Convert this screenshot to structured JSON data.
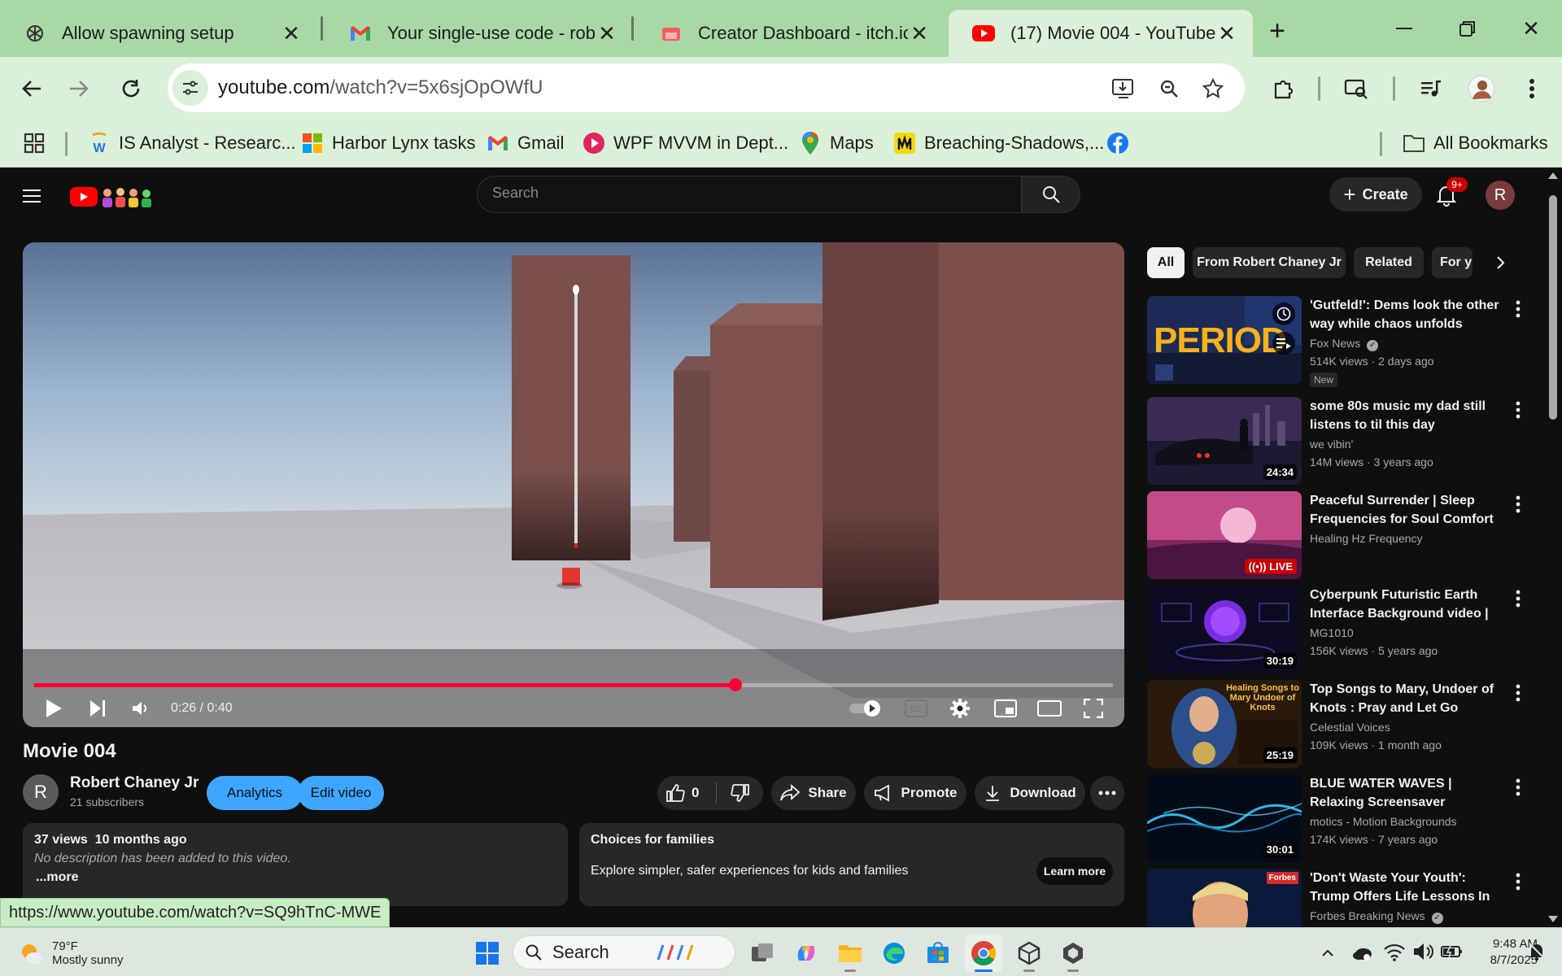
{
  "browser": {
    "tabs": [
      {
        "title": "Allow spawning setup",
        "active": false
      },
      {
        "title": "Your single-use code - rober",
        "active": false
      },
      {
        "title": "Creator Dashboard - itch.io",
        "active": false
      },
      {
        "title": "(17) Movie 004 - YouTube",
        "active": true
      }
    ],
    "url_host": "youtube.com",
    "url_path": "/watch?v=5x6sjOpOWfU",
    "bookmarks": [
      {
        "label": "IS Analyst - Researc...",
        "icon": "w-icon"
      },
      {
        "label": "Harbor Lynx tasks",
        "icon": "microsoft-icon"
      },
      {
        "label": "Gmail",
        "icon": "gmail-icon"
      },
      {
        "label": "WPF MVVM in Dept...",
        "icon": "play-icon"
      },
      {
        "label": "Maps",
        "icon": "maps-icon"
      },
      {
        "label": "Breaching-Shadows,...",
        "icon": "itch-icon"
      },
      {
        "label": "",
        "icon": "facebook-icon"
      }
    ],
    "all_bookmarks": "All Bookmarks"
  },
  "youtube": {
    "search_placeholder": "Search",
    "create_label": "Create",
    "notif_badge": "9+",
    "avatar_letter": "R",
    "player": {
      "time": "0:26 / 0:40",
      "progress": 0.65
    },
    "video": {
      "title": "Movie 004",
      "channel": "Robert Chaney Jr",
      "channel_letter": "R",
      "subscribers": "21 subscribers",
      "analytics_label": "Analytics",
      "edit_label": "Edit video",
      "likes": "0",
      "share_label": "Share",
      "promote_label": "Promote",
      "download_label": "Download"
    },
    "description": {
      "stats": "37 views  10 months ago",
      "text": "No description has been added to this video.",
      "more": "...more"
    },
    "families": {
      "title": "Choices for families",
      "text": "Explore simpler, safer experiences for kids and families",
      "button": "Learn more"
    },
    "chips": [
      "All",
      "From Robert Chaney Jr",
      "Related",
      "For y"
    ],
    "recommendations": [
      {
        "title": "'Gutfeld!': Dems look the other way while chaos unfolds",
        "channel": "Fox News",
        "verified": true,
        "meta": "514K views · 2 days ago",
        "badge": "New",
        "duration": "",
        "thumb_text": "PERIOD"
      },
      {
        "title": "some 80s music my dad still listens to til this day",
        "channel": "we vibin'",
        "verified": false,
        "meta": "14M views · 3 years ago",
        "badge": "",
        "duration": "24:34",
        "thumb_text": ""
      },
      {
        "title": "Peaceful Surrender | Sleep Frequencies for Soul Comfort",
        "channel": "Healing Hz Frequency",
        "verified": false,
        "meta": "",
        "badge": "",
        "duration": "LIVE",
        "thumb_text": ""
      },
      {
        "title": "Cyberpunk Futuristic Earth Interface Background video | ...",
        "channel": "MG1010",
        "verified": false,
        "meta": "156K views · 5 years ago",
        "badge": "",
        "duration": "30:19",
        "thumb_text": ""
      },
      {
        "title": "Top Songs to Mary, Undoer of Knots : Pray and Let Go",
        "channel": "Celestial Voices",
        "verified": false,
        "meta": "109K views · 1 month ago",
        "badge": "",
        "duration": "25:19",
        "thumb_text": "Healing Songs to Mary Undoer of Knots"
      },
      {
        "title": "BLUE WATER WAVES | Relaxing Screensaver",
        "channel": "motics - Motion Backgrounds",
        "verified": false,
        "meta": "174K views · 7 years ago",
        "badge": "",
        "duration": "30:01",
        "thumb_text": ""
      },
      {
        "title": "'Don't Waste Your Youth': Trump Offers Life Lessons In ...",
        "channel": "Forbes Breaking News",
        "verified": true,
        "meta": "",
        "badge": "",
        "duration": "",
        "thumb_text": "Forbes"
      }
    ]
  },
  "status_url": "https://www.youtube.com/watch?v=SQ9hTnC-MWE",
  "taskbar": {
    "weather_temp": "79°F",
    "weather_desc": "Mostly sunny",
    "search_label": "Search",
    "time": "9:48 AM",
    "date": "8/7/2025"
  }
}
